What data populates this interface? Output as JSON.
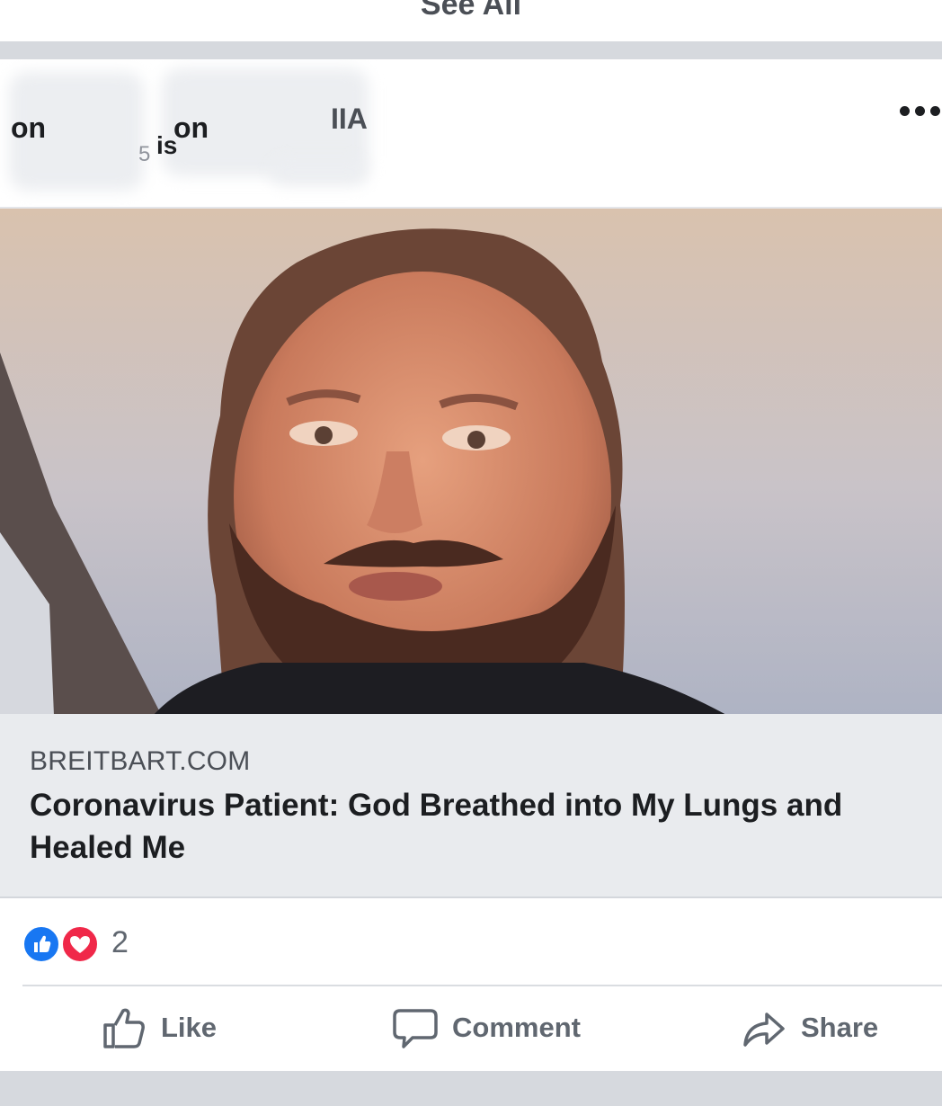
{
  "top": {
    "see_all_label": "See All"
  },
  "post_header": {
    "fragment_1": "on",
    "fragment_2": "on",
    "fragment_3": "is",
    "fragment_4": "5",
    "fragment_5": "IIA"
  },
  "link_preview": {
    "domain": "BREITBART.COM",
    "headline": "Coronavirus Patient: God Breathed into My Lungs and Healed Me"
  },
  "reactions": {
    "count": "2",
    "types": [
      "like",
      "love"
    ]
  },
  "actions": {
    "like_label": "Like",
    "comment_label": "Comment",
    "share_label": "Share"
  },
  "icons": {
    "more": "more-options-icon",
    "like": "thumbs-up-icon",
    "comment": "speech-bubble-icon",
    "share": "share-arrow-icon",
    "reaction_like": "like-reaction-icon",
    "reaction_love": "love-reaction-icon"
  },
  "colors": {
    "like_blue": "#1877f2",
    "love_red": "#f02849",
    "link_bg": "#e9ebee",
    "action_gray": "#606770"
  }
}
